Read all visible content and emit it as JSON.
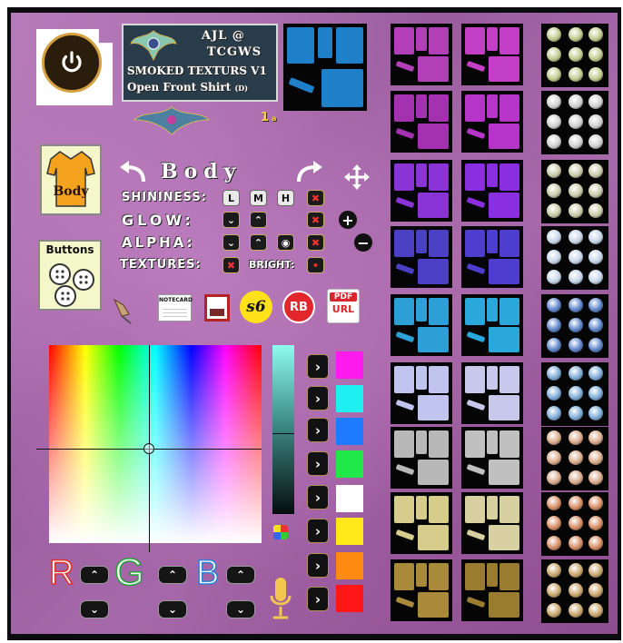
{
  "header": {
    "brand_line1": "AJL @",
    "brand_line2": "TCGWS",
    "product_line1": "SMOKED TEXTURS V1",
    "product_line2": "Open Front Shirt",
    "product_variant": "(D)",
    "page_number": "1",
    "page_suffix": "a"
  },
  "sections": {
    "body_label": "Body",
    "body_title": "Body",
    "buttons_label": "Buttons"
  },
  "controls": {
    "shininess_label": "SHININESS:",
    "shininess_low": "L",
    "shininess_medium": "M",
    "shininess_high": "H",
    "glow_label": "GLOW:",
    "alpha_label": "ALPHA:",
    "textures_label": "TEXTURES:",
    "bright_label": "BRIGHT:"
  },
  "links": {
    "notecard_label": "NOTECARD",
    "s6_label": "s6",
    "rb_label": "RB",
    "pdf_label": "PDF",
    "url_label": "URL"
  },
  "rgb": {
    "r_label": "R",
    "g_label": "G",
    "b_label": "B"
  },
  "colors": {
    "preset_swatches": [
      "#ff1aee",
      "#1ef0f2",
      "#1e7bff",
      "#1fe84a",
      "#ffffff",
      "#ffe81a",
      "#ff8a12",
      "#ff1616"
    ],
    "body_shirt_color": "#f5a21f"
  },
  "texture_tint_rows": [
    "#b33fb8",
    "#a431b0",
    "#8a33d6",
    "#4b3fc4",
    "#2ea0d8",
    "#c0c4ee",
    "#b8b8b8",
    "#d6cc8c",
    "#a88a3a"
  ],
  "texture_tint_rows_col2": [
    "#c23fc6",
    "#b535c8",
    "#8a2fe0",
    "#4d3ed0",
    "#2aa8dc",
    "#c8c8ec",
    "#c0c0c0",
    "#d8d0a0",
    "#9a7c30"
  ],
  "button_tint_rows": [
    "#bfc88a",
    "#cfcfcf",
    "#c9c9a8",
    "#c4d4e8",
    "#5a82c8",
    "#7aaad6",
    "#d8a888",
    "#d48a60",
    "#c8a46a"
  ],
  "icons": {
    "power": "power-icon",
    "move": "move-arrows-icon",
    "plus": "plus-icon",
    "minus": "minus-icon",
    "undo": "curved-arrow-left-icon",
    "redo": "curved-arrow-right-icon",
    "pin": "push-pin-icon",
    "image": "image-frame-icon",
    "microphone": "microphone-icon",
    "palette": "palette-icon"
  }
}
